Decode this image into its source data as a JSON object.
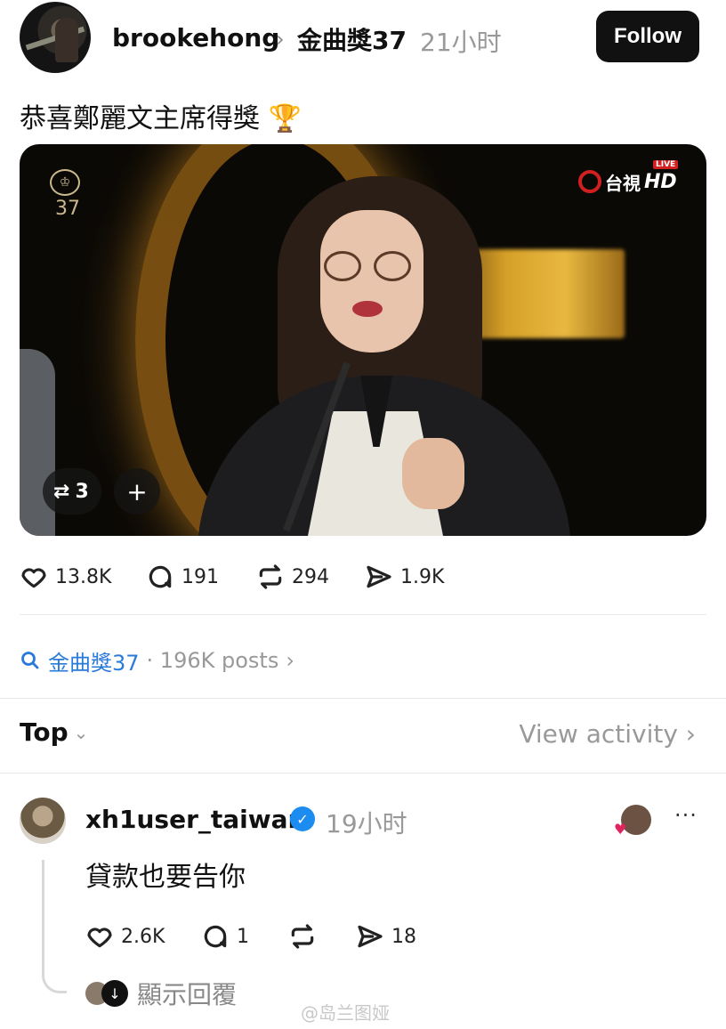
{
  "post": {
    "author": "brookehong",
    "topic": "金曲獎37",
    "time": "21小时",
    "follow_label": "Follow",
    "caption": "恭喜鄭麗文主席得獎 🏆",
    "video": {
      "channel_logo": "台視",
      "hd_label": "HD",
      "live_label": "LIVE",
      "event_number": "37",
      "repost_count": "3",
      "add_label": "+"
    },
    "stats": {
      "likes": "13.8K",
      "comments": "191",
      "reposts": "294",
      "shares": "1.9K"
    }
  },
  "tag": {
    "name": "金曲獎37",
    "count": "· 196K posts",
    "chevron": "›"
  },
  "sort": {
    "label": "Top",
    "chevron": "⌄",
    "view_activity": "View activity ›"
  },
  "reply": {
    "user": "xh1user_taiwan",
    "time": "19小时",
    "text": "貸款也要告你",
    "more": "···",
    "stats": {
      "likes": "2.6K",
      "comments": "1",
      "shares": "18"
    },
    "show_replies": "顯示回覆"
  },
  "watermark": "@岛兰图娅"
}
